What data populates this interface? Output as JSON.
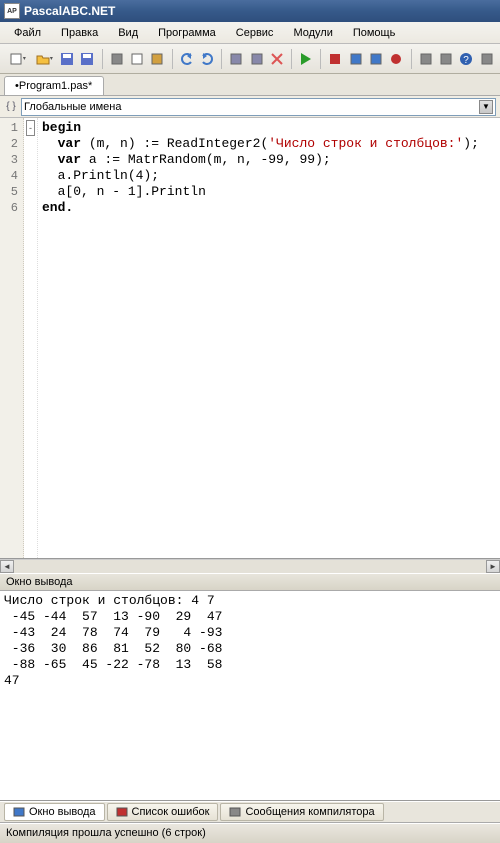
{
  "title": "PascalABC.NET",
  "menu": [
    "Файл",
    "Правка",
    "Вид",
    "Программа",
    "Сервис",
    "Модули",
    "Помощь"
  ],
  "toolbar_icons": [
    "new",
    "open",
    "save",
    "saveall",
    "cut",
    "copy",
    "paste",
    "undo",
    "redo",
    "tile",
    "cascade",
    "close",
    "run",
    "stop",
    "stepinto",
    "stepover",
    "breakpoint",
    "mode-normal",
    "mode-expand",
    "help",
    "options"
  ],
  "tab": "•Program1.pas*",
  "scope": "Глобальные имена",
  "code_lines": [
    {
      "n": "1",
      "fold": "-",
      "text": "begin",
      "cls": "kw"
    },
    {
      "n": "2",
      "fold": "",
      "raw": [
        [
          "kw",
          "  var"
        ],
        [
          "",
          " (m, n) := ReadInteger2("
        ],
        [
          "str",
          "'Число строк и столбцов:'"
        ],
        [
          "",
          ");"
        ]
      ]
    },
    {
      "n": "3",
      "fold": "",
      "raw": [
        [
          "kw",
          "  var"
        ],
        [
          "",
          " a := MatrRandom(m, n, "
        ],
        [
          "num",
          "-99"
        ],
        [
          "",
          ", "
        ],
        [
          "num",
          "99"
        ],
        [
          "",
          ");"
        ]
      ]
    },
    {
      "n": "4",
      "fold": "",
      "raw": [
        [
          "",
          "  a.Println("
        ],
        [
          "num",
          "4"
        ],
        [
          "",
          ");"
        ]
      ]
    },
    {
      "n": "5",
      "fold": "",
      "raw": [
        [
          "",
          "  a["
        ],
        [
          "num",
          "0"
        ],
        [
          "",
          ", n - "
        ],
        [
          "num",
          "1"
        ],
        [
          "",
          "].Println"
        ]
      ]
    },
    {
      "n": "6",
      "fold": "",
      "text": "end.",
      "cls": "kw"
    }
  ],
  "output_title": "Окно вывода",
  "output_text": "Число строк и столбцов: 4 7\n -45 -44  57  13 -90  29  47\n -43  24  78  74  79   4 -93\n -36  30  86  81  52  80 -68\n -88 -65  45 -22 -78  13  58\n47",
  "bottom_tabs": [
    {
      "label": "Окно вывода",
      "active": true,
      "icon": "out"
    },
    {
      "label": "Список ошибок",
      "active": false,
      "icon": "err"
    },
    {
      "label": "Сообщения компилятора",
      "active": false,
      "icon": "msg"
    }
  ],
  "status": "Компиляция прошла успешно (6 строк)"
}
